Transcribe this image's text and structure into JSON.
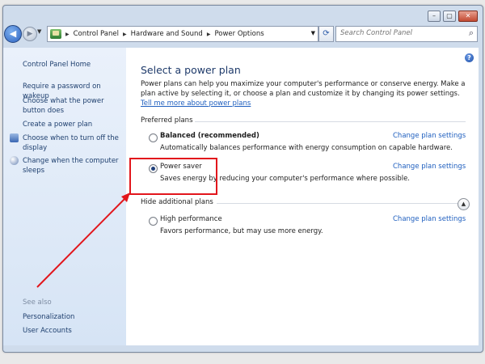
{
  "window": {
    "title_buttons": [
      "minimize",
      "maximize",
      "close"
    ]
  },
  "nav": {
    "breadcrumb": [
      "Control Panel",
      "Hardware and Sound",
      "Power Options"
    ],
    "search_placeholder": "Search Control Panel"
  },
  "sidebar": {
    "home": "Control Panel Home",
    "links": [
      "Require a password on wakeup",
      "Choose what the power button does",
      "Create a power plan",
      "Choose when to turn off the display",
      "Change when the computer sleeps"
    ],
    "see_also": "See also",
    "see_also_links": [
      "Personalization",
      "User Accounts"
    ]
  },
  "main": {
    "title": "Select a power plan",
    "description": "Power plans can help you maximize your computer's performance or conserve energy. Make a plan active by selecting it, or choose a plan and customize it by changing its power settings.",
    "description_link": "Tell me more about power plans",
    "preferred_label": "Preferred plans",
    "hide_label": "Hide additional plans",
    "change_label": "Change plan settings",
    "plans": [
      {
        "name": "Balanced (recommended)",
        "description": "Automatically balances performance with energy consumption on capable hardware.",
        "selected": false
      },
      {
        "name": "Power saver",
        "description": "Saves energy by reducing your computer's performance where possible.",
        "selected": true
      },
      {
        "name": "High performance",
        "description": "Favors performance, but may use more energy.",
        "selected": false
      }
    ]
  },
  "annotation": {
    "highlight_color": "#e2161c"
  },
  "icons": [
    "back-arrow-icon",
    "forward-arrow-icon",
    "control-panel-icon",
    "refresh-icon",
    "search-icon",
    "help-icon",
    "shield-icon",
    "monitor-icon",
    "moon-icon",
    "chevron-up-icon"
  ]
}
